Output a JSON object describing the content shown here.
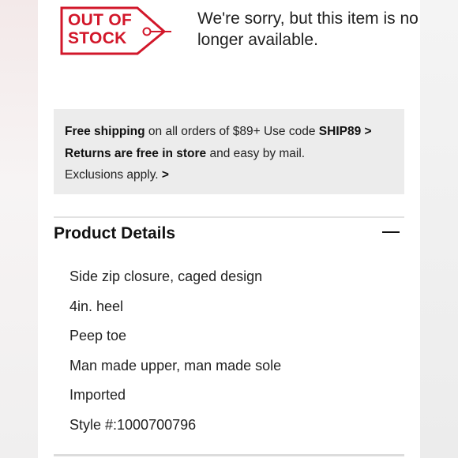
{
  "out_of_stock": {
    "line1": "OUT OF",
    "line2": "STOCK",
    "message": "We're sorry, but this item is no longer available.",
    "color": "#d2172a"
  },
  "promo": {
    "shipping_bold": "Free shipping",
    "shipping_rest": " on all orders of $89+ Use code ",
    "code": "SHIP89",
    "chevron": ">",
    "returns_bold": "Returns are free in store",
    "returns_rest": " and easy by mail.",
    "exclusions": "Exclusions apply.",
    "exclusions_chevron": ">"
  },
  "product_details": {
    "title": "Product Details",
    "collapse_icon": "minus-icon",
    "items": [
      "Side zip closure, caged design",
      "4in. heel",
      "Peep toe",
      "Man made upper, man made sole",
      "Imported",
      "Style #:1000700796"
    ]
  }
}
